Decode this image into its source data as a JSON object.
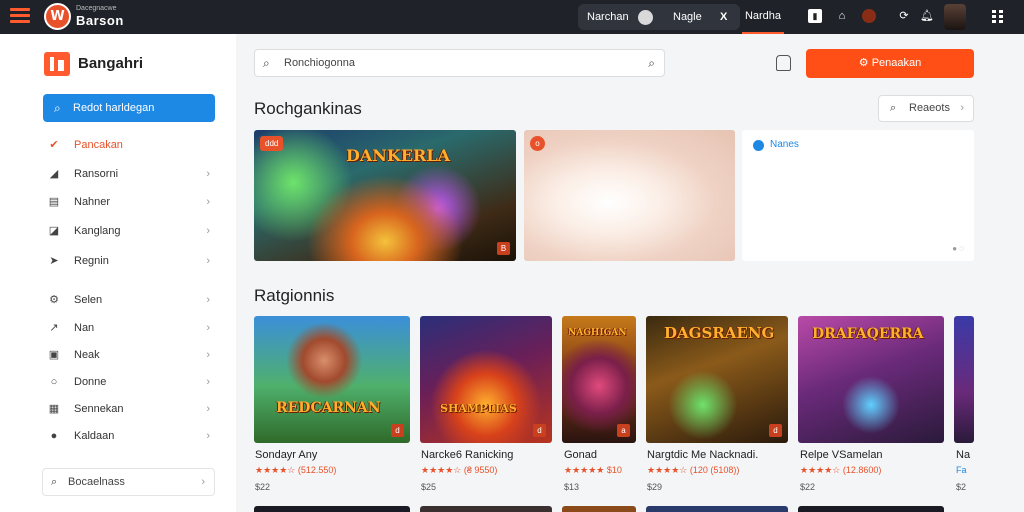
{
  "topbar": {
    "logo_small": "Dacegnacwe",
    "logo_big": "Barson",
    "logo_badge": "W",
    "nav_1": "Narchan",
    "nav_2": "Nagle",
    "nav_3": "Nardha",
    "x_label": "X"
  },
  "sidebar": {
    "brand": "Bangahri",
    "primary_label": "Redot harldegan",
    "items": [
      {
        "label": "Pancakan",
        "icon": "flame-icon"
      },
      {
        "label": "Ransorni",
        "icon": "bookmark-icon"
      },
      {
        "label": "Nahner",
        "icon": "list-icon"
      },
      {
        "label": "Kanglang",
        "icon": "tag-icon"
      },
      {
        "label": "Regnin",
        "icon": "send-icon"
      },
      {
        "label": "Selen",
        "icon": "gear-icon"
      },
      {
        "label": "Nan",
        "icon": "arrow-icon"
      },
      {
        "label": "Neak",
        "icon": "image-icon"
      },
      {
        "label": "Donne",
        "icon": "circle-icon"
      },
      {
        "label": "Sennekan",
        "icon": "grid-icon"
      },
      {
        "label": "Kaldaan",
        "icon": "dot-icon"
      }
    ],
    "search_label": "Bocaelnass"
  },
  "header": {
    "search_placeholder": "Ronchiogonna",
    "cta_label": "Penaakan"
  },
  "featured": {
    "title": "Rochgankinas",
    "see_all": "Reaeots",
    "cards": [
      {
        "tag": "ddd",
        "title": "DANKERLA",
        "corner": "B"
      },
      {
        "tag": "o",
        "title": "",
        "corner": ""
      },
      {
        "tag": "",
        "title": "Nanes",
        "corner": ""
      }
    ]
  },
  "games": {
    "title": "Ratgionnis",
    "items": [
      {
        "art_title": "REDCARNAN",
        "name": "Sondayr Any",
        "rating": "★★★★☆ (512.550)",
        "price": "$22",
        "corner": "d"
      },
      {
        "art_title": "SHAMPLIAS",
        "name": "Narcke6 Ranicking",
        "rating": "★★★★☆ (₴ 9550)",
        "price": "$25",
        "corner": "d"
      },
      {
        "art_title": "NAGHIGAN",
        "name": "Gonad",
        "rating": "★★★★★ $10",
        "price": "$13",
        "corner": "a"
      },
      {
        "art_title": "DAGSRAENG",
        "name": "Nargtdic Me Nacknadi.",
        "rating": "★★★★☆ (120 (5108))",
        "price": "$29",
        "corner": "d"
      },
      {
        "art_title": "DRAFAQERRA",
        "name": "Relpe VSamelan",
        "rating": "★★★★☆ (12.8600)",
        "price": "$22",
        "corner": ""
      },
      {
        "art_title": "",
        "name": "Na",
        "rating": "Fa",
        "price": "$2",
        "corner": ""
      }
    ]
  }
}
